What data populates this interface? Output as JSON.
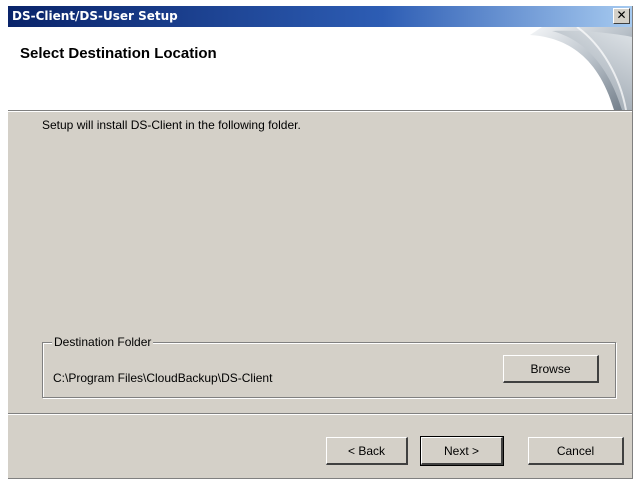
{
  "window": {
    "title": "DS-Client/DS-User Setup",
    "close_glyph": "✕"
  },
  "header": {
    "title": "Select Destination Location",
    "graphic_icon": "page-curl-graphic"
  },
  "body": {
    "description": "Setup will install DS-Client in the following folder."
  },
  "destination": {
    "group_label": "Destination Folder",
    "path": "C:\\Program Files\\CloudBackup\\DS-Client",
    "browse_label": "Browse"
  },
  "footer": {
    "back_label": "< Back",
    "next_label": "Next >",
    "cancel_label": "Cancel"
  },
  "colors": {
    "dialog_bg": "#d4d0c8",
    "titlebar_start": "#0a246a",
    "titlebar_end": "#a6caf0"
  }
}
